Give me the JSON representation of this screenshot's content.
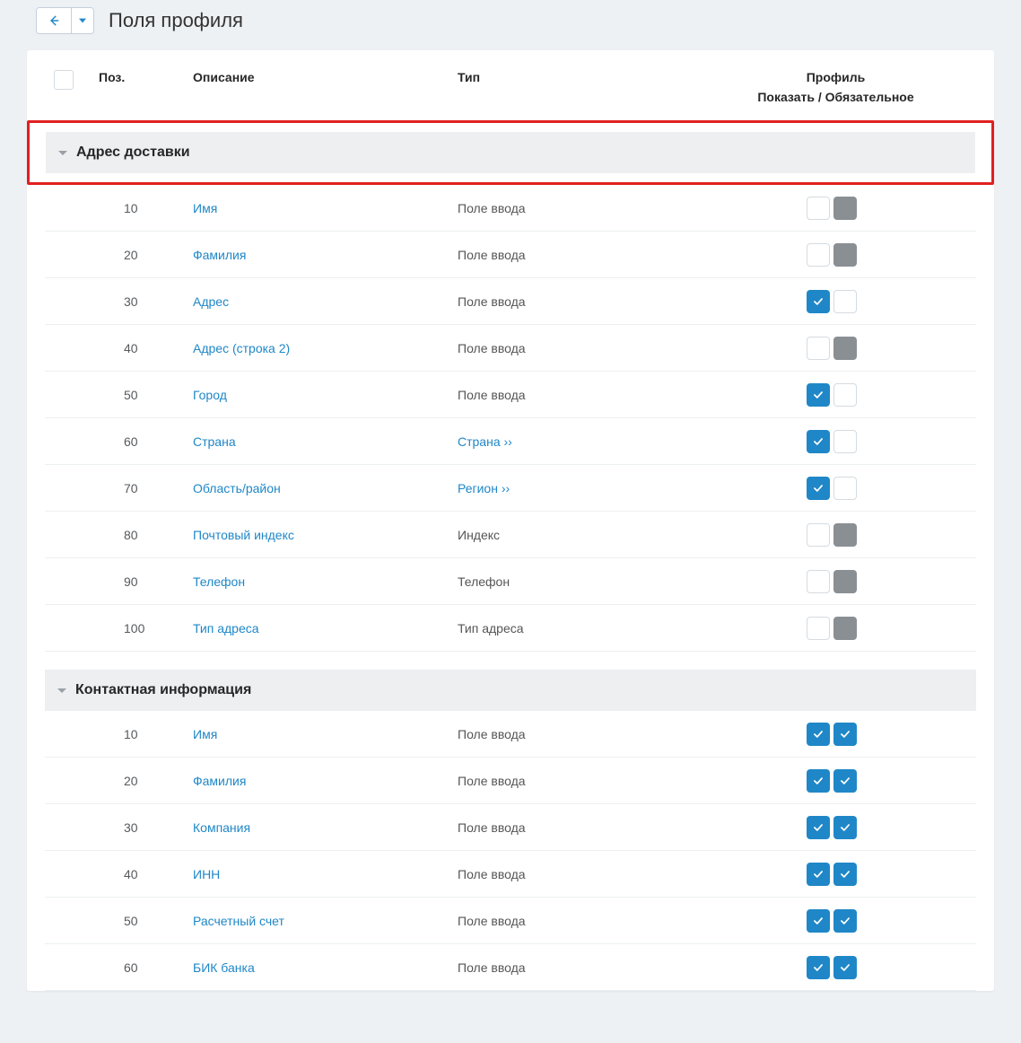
{
  "page": {
    "title": "Поля профиля"
  },
  "columns": {
    "pos": "Поз.",
    "desc": "Описание",
    "type": "Тип",
    "profile": "Профиль",
    "profile_sub": "Показать / Обязательное"
  },
  "sections": [
    {
      "key": "delivery",
      "title": "Адрес доставки",
      "highlighted": true,
      "rows": [
        {
          "pos": "10",
          "desc": "Имя",
          "type_text": "Поле ввода",
          "type_link": false,
          "show": "empty",
          "req": "gray"
        },
        {
          "pos": "20",
          "desc": "Фамилия",
          "type_text": "Поле ввода",
          "type_link": false,
          "show": "empty",
          "req": "gray"
        },
        {
          "pos": "30",
          "desc": "Адрес",
          "type_text": "Поле ввода",
          "type_link": false,
          "show": "blue",
          "req": "empty"
        },
        {
          "pos": "40",
          "desc": "Адрес (строка 2)",
          "type_text": "Поле ввода",
          "type_link": false,
          "show": "empty",
          "req": "gray"
        },
        {
          "pos": "50",
          "desc": "Город",
          "type_text": "Поле ввода",
          "type_link": false,
          "show": "blue",
          "req": "empty"
        },
        {
          "pos": "60",
          "desc": "Страна",
          "type_text": "Страна ››",
          "type_link": true,
          "show": "blue",
          "req": "empty"
        },
        {
          "pos": "70",
          "desc": "Область/район",
          "type_text": "Регион ››",
          "type_link": true,
          "show": "blue",
          "req": "empty"
        },
        {
          "pos": "80",
          "desc": "Почтовый индекс",
          "type_text": "Индекс",
          "type_link": false,
          "show": "empty",
          "req": "gray"
        },
        {
          "pos": "90",
          "desc": "Телефон",
          "type_text": "Телефон",
          "type_link": false,
          "show": "empty",
          "req": "gray"
        },
        {
          "pos": "100",
          "desc": "Тип адреса",
          "type_text": "Тип адреса",
          "type_link": false,
          "show": "empty",
          "req": "gray"
        }
      ]
    },
    {
      "key": "contact",
      "title": "Контактная информация",
      "highlighted": false,
      "rows": [
        {
          "pos": "10",
          "desc": "Имя",
          "type_text": "Поле ввода",
          "type_link": false,
          "show": "blue",
          "req": "blue"
        },
        {
          "pos": "20",
          "desc": "Фамилия",
          "type_text": "Поле ввода",
          "type_link": false,
          "show": "blue",
          "req": "blue"
        },
        {
          "pos": "30",
          "desc": "Компания",
          "type_text": "Поле ввода",
          "type_link": false,
          "show": "blue",
          "req": "blue"
        },
        {
          "pos": "40",
          "desc": "ИНН",
          "type_text": "Поле ввода",
          "type_link": false,
          "show": "blue",
          "req": "blue"
        },
        {
          "pos": "50",
          "desc": "Расчетный счет",
          "type_text": "Поле ввода",
          "type_link": false,
          "show": "blue",
          "req": "blue"
        },
        {
          "pos": "60",
          "desc": "БИК банка",
          "type_text": "Поле ввода",
          "type_link": false,
          "show": "blue",
          "req": "blue"
        }
      ]
    }
  ]
}
